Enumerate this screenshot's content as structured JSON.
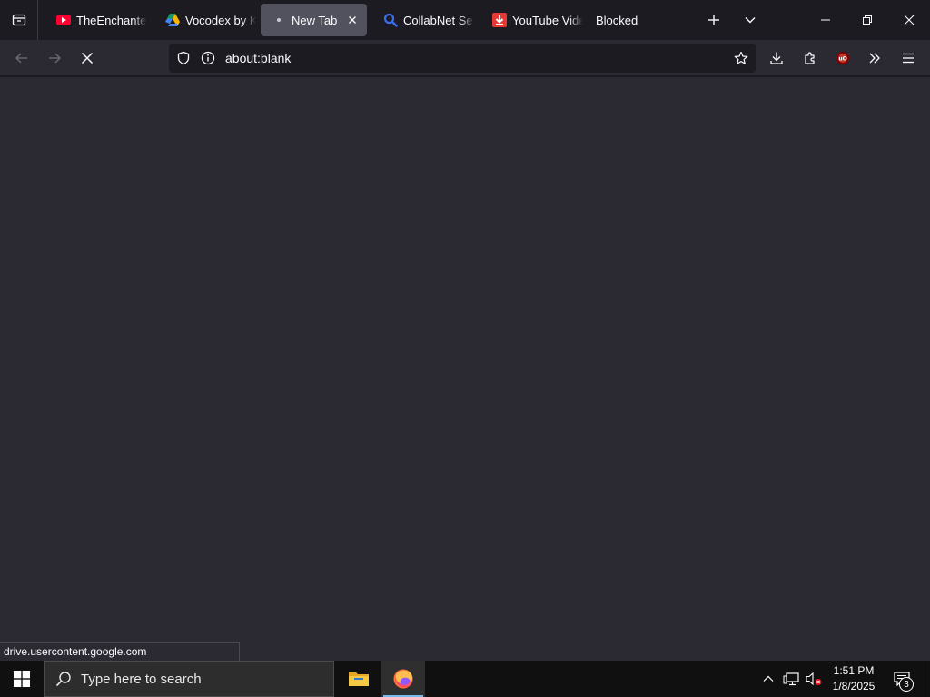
{
  "browser": {
    "tabs": [
      {
        "label": "TheEnchanted",
        "icon": "youtube-icon"
      },
      {
        "label": "Vocodex by Ki",
        "icon": "google-drive-icon"
      },
      {
        "label": "New Tab",
        "icon": "dot-icon",
        "selected": true
      },
      {
        "label": "CollabNet Sear",
        "icon": "search-icon"
      },
      {
        "label": "YouTube Video",
        "icon": "download-icon"
      },
      {
        "label": "Blocked",
        "icon": ""
      }
    ],
    "url": "about:blank",
    "status_text": "drive.usercontent.google.com"
  },
  "taskbar": {
    "search_placeholder": "Type here to search",
    "clock_time": "1:51 PM",
    "clock_date": "1/8/2025",
    "notification_count": "3"
  },
  "colors": {
    "accent_blue": "#76b9ed",
    "tab_selected": "#52525e",
    "toolbar_bg": "#2b2a33",
    "frame_bg": "#1c1b22",
    "taskbar_bg": "#101010"
  }
}
